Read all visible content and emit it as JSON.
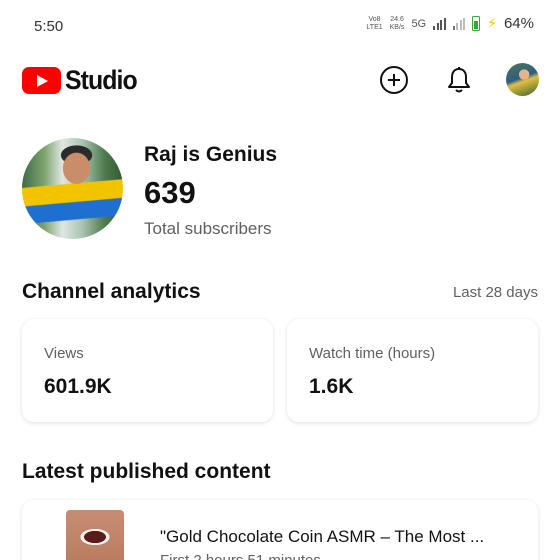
{
  "status_bar": {
    "time": "5:50",
    "volte_top": "Vo8",
    "volte_bottom": "LTE1",
    "speed_value": "24.6",
    "speed_unit": "KB/s",
    "network": "5G",
    "battery_percent": "64%",
    "battery_color": "#3aa33a"
  },
  "header": {
    "logo_text": "Studio",
    "brand_color": "#ff0000",
    "icons": [
      "add-circle-icon",
      "bell-icon"
    ]
  },
  "channel": {
    "name": "Raj is Genius",
    "subscriber_count": "639",
    "subscriber_label": "Total subscribers"
  },
  "analytics": {
    "title": "Channel analytics",
    "period": "Last 28 days",
    "cards": [
      {
        "label": "Views",
        "value": "601.9K"
      },
      {
        "label": "Watch time (hours)",
        "value": "1.6K"
      }
    ]
  },
  "latest": {
    "title": "Latest published content",
    "item": {
      "title": "\"Gold Chocolate Coin ASMR – The Most ...",
      "subtitle": "First 2 hours 51 minutes"
    }
  }
}
